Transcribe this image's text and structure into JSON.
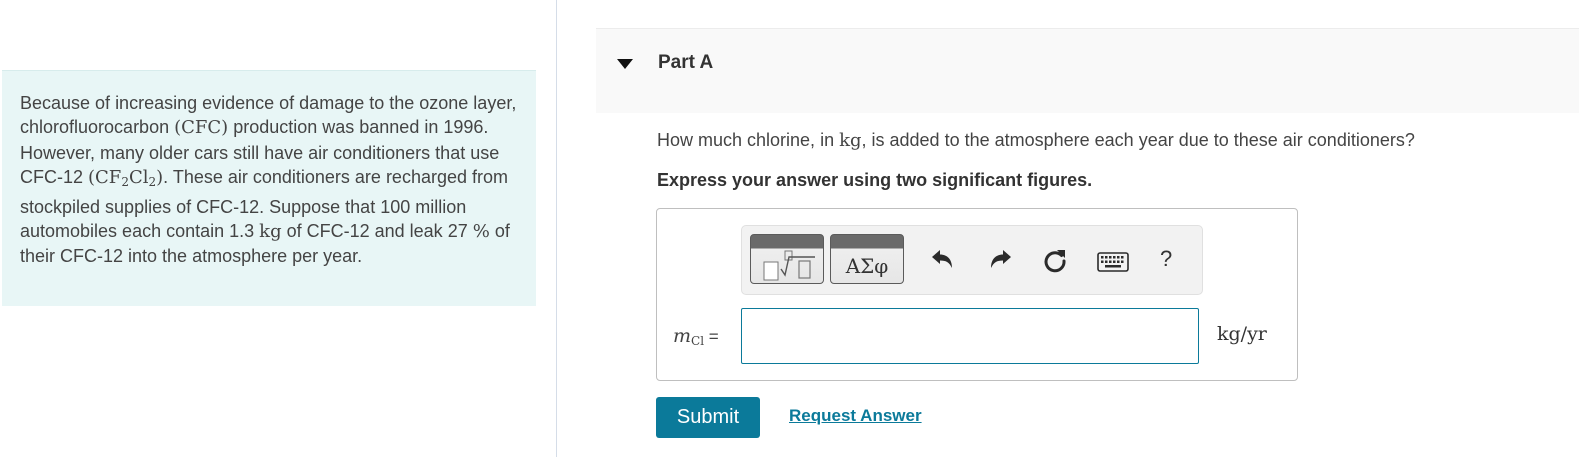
{
  "problem": {
    "t1": "Because of increasing evidence of damage to the ozone layer, chlorofluorocarbon ",
    "cfc": "(CFC)",
    "t2": " production was banned in 1996. However, many older cars still have air conditioners that use CFC-12 ",
    "f_open": "(CF",
    "f_sub1": "2",
    "f_mid": "Cl",
    "f_sub2": "2",
    "f_close": ")",
    "t3": ". These air conditioners are recharged from stockpiled supplies of CFC-12. Suppose that 100 million automobiles each contain 1.3 ",
    "unit_kg": "kg",
    "t4": " of CFC-12 and leak 27 ",
    "pct": "%",
    "t5": " of their CFC-12 into the atmosphere per year."
  },
  "part": {
    "title": "Part A",
    "question_pre": "How much chlorine, in ",
    "question_unit": "kg",
    "question_post": ", is added to the atmosphere each year due to these air conditioners?",
    "instruction": "Express your answer using two significant figures."
  },
  "toolbar": {
    "greek_label": "ΑΣφ",
    "help_label": "?"
  },
  "answer": {
    "var_symbol": "m",
    "var_subscript": "Cl",
    "equals": " =",
    "value": "",
    "units": "kg/yr"
  },
  "actions": {
    "submit_label": "Submit",
    "request_label": "Request Answer"
  },
  "colors": {
    "accent": "#0b7a9a",
    "problem_bg": "#e8f6f6"
  },
  "icons": [
    "caret-down-icon",
    "templates-icon",
    "undo-icon",
    "redo-icon",
    "reset-icon",
    "keyboard-icon",
    "help-icon"
  ]
}
